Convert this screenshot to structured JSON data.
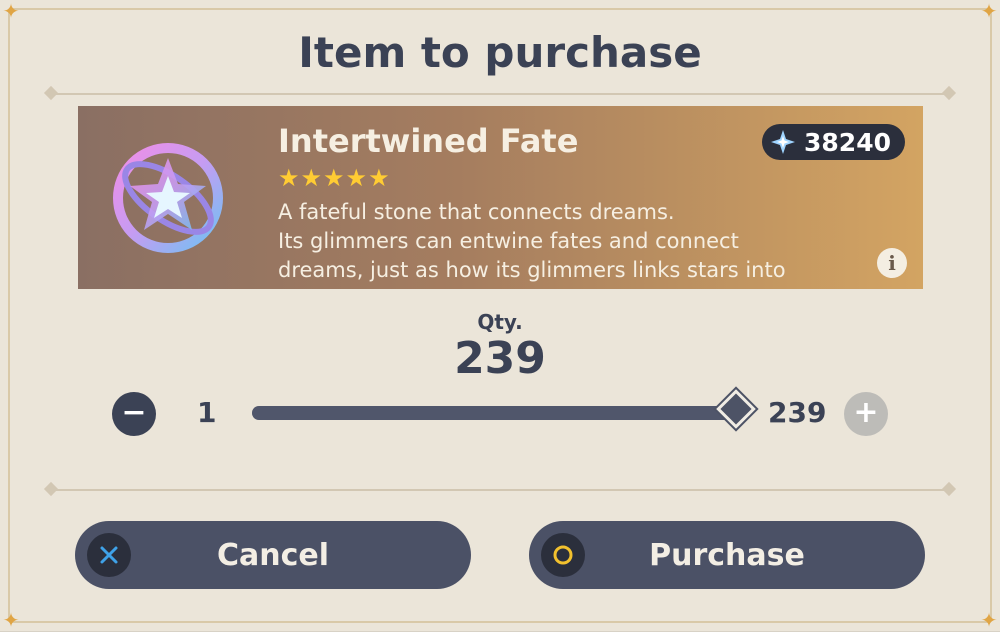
{
  "dialog": {
    "title": "Item to purchase"
  },
  "item": {
    "name": "Intertwined Fate",
    "rarity_stars": "★★★★★",
    "currency_icon": "primogem-icon",
    "currency_amount": "38240",
    "description_lines": [
      "A fateful stone that connects dreams.",
      "Its glimmers can entwine fates and connect",
      "dreams, just as how its glimmers links stars into"
    ],
    "info_icon": "i"
  },
  "quantity": {
    "label": "Qty.",
    "value": "239",
    "min_label": "1",
    "max_label": "239",
    "slider_fraction": 1.0,
    "minus_symbol": "−",
    "plus_symbol": "+"
  },
  "buttons": {
    "cancel_label": "Cancel",
    "purchase_label": "Purchase"
  },
  "colors": {
    "accent_dark": "#3b4255",
    "button_bg": "#4b5166",
    "cancel_icon": "#3fa2e8",
    "purchase_icon": "#f2c12e",
    "star": "#ffcc33"
  }
}
